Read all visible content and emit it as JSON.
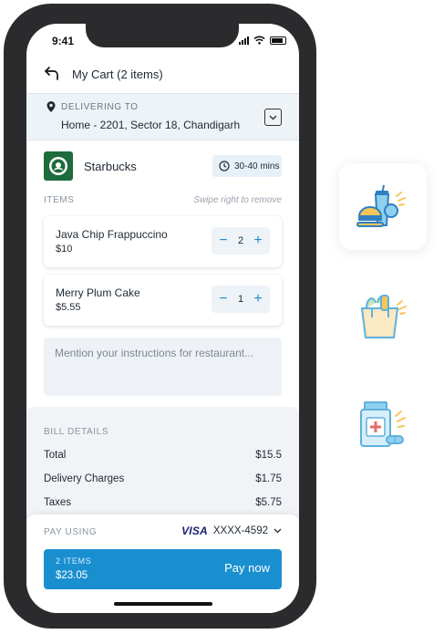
{
  "status_bar": {
    "time": "9:41"
  },
  "header": {
    "title": "My Cart (2 items)"
  },
  "delivery": {
    "label": "DELIVERING TO",
    "address": "Home - 2201, Sector 18, Chandigarh"
  },
  "restaurant": {
    "name": "Starbucks",
    "eta": "30-40 mins"
  },
  "items_section": {
    "label": "ITEMS",
    "hint": "Swipe right to remove"
  },
  "items": [
    {
      "name": "Java Chip Frappuccino",
      "price": "$10",
      "qty": "2"
    },
    {
      "name": "Merry Plum Cake",
      "price": "$5.55",
      "qty": "1"
    }
  ],
  "stepper": {
    "minus": "−",
    "plus": "+"
  },
  "instructions": {
    "placeholder": "Mention your instructions for restaurant..."
  },
  "bill": {
    "label": "BILL DETAILS",
    "rows": [
      {
        "label": "Total",
        "value": "$15.5"
      },
      {
        "label": "Delivery Charges",
        "value": "$1.75"
      },
      {
        "label": "Taxes",
        "value": "$5.75"
      }
    ]
  },
  "payment": {
    "label": "PAY USING",
    "card_brand": "VISA",
    "card_number": "XXXX-4592",
    "button": {
      "count": "2 ITEMS",
      "total": "$23.05",
      "action": "Pay now"
    }
  },
  "side_icons": [
    "food-icon",
    "grocery-icon",
    "medicine-icon"
  ],
  "colors": {
    "accent": "#1a8fd0",
    "starbucks_green": "#1e6b3c",
    "panel_bg": "#eef3f8"
  }
}
